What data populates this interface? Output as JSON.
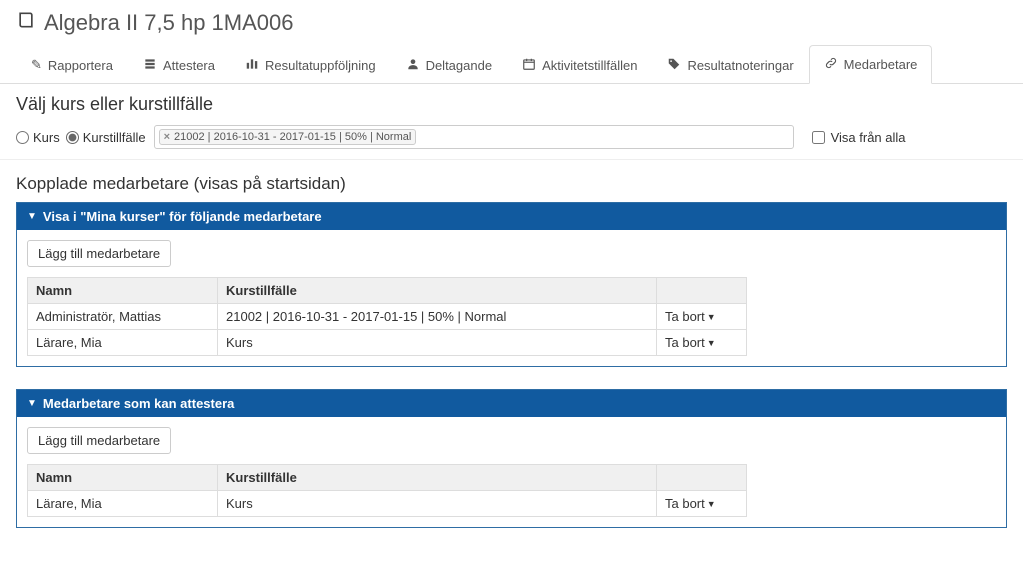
{
  "page_title": "Algebra II 7,5 hp 1MA006",
  "tabs": [
    {
      "icon": "pencil",
      "label": "Rapportera",
      "active": false
    },
    {
      "icon": "check",
      "label": "Attestera",
      "active": false
    },
    {
      "icon": "chart",
      "label": "Resultatuppföljning",
      "active": false
    },
    {
      "icon": "user",
      "label": "Deltagande",
      "active": false
    },
    {
      "icon": "calendar",
      "label": "Aktivitetstillfällen",
      "active": false
    },
    {
      "icon": "tag",
      "label": "Resultatnoteringar",
      "active": false
    },
    {
      "icon": "link",
      "label": "Medarbetare",
      "active": true
    }
  ],
  "select_heading": "Välj kurs eller kurstillfälle",
  "radios": {
    "kurs": "Kurs",
    "kurstillfalle": "Kurstillfälle",
    "selected": "kurstillfalle"
  },
  "token_text": "21002 | 2016-10-31 - 2017-01-15 | 50% | Normal",
  "show_all_label": "Visa från alla",
  "show_all_checked": false,
  "section_title": "Kopplade medarbetare (visas på startsidan)",
  "panel1": {
    "title": "Visa i \"Mina kurser\" för följande medarbetare",
    "add_label": "Lägg till medarbetare",
    "columns": {
      "name": "Namn",
      "inst": "Kurstillfälle"
    },
    "rows": [
      {
        "name": "Administratör, Mattias",
        "inst": "21002 | 2016-10-31 - 2017-01-15 | 50% | Normal",
        "action": "Ta bort"
      },
      {
        "name": "Lärare, Mia",
        "inst": "Kurs",
        "action": "Ta bort"
      }
    ]
  },
  "panel2": {
    "title": "Medarbetare som kan attestera",
    "add_label": "Lägg till medarbetare",
    "columns": {
      "name": "Namn",
      "inst": "Kurstillfälle"
    },
    "rows": [
      {
        "name": "Lärare, Mia",
        "inst": "Kurs",
        "action": "Ta bort"
      }
    ]
  }
}
